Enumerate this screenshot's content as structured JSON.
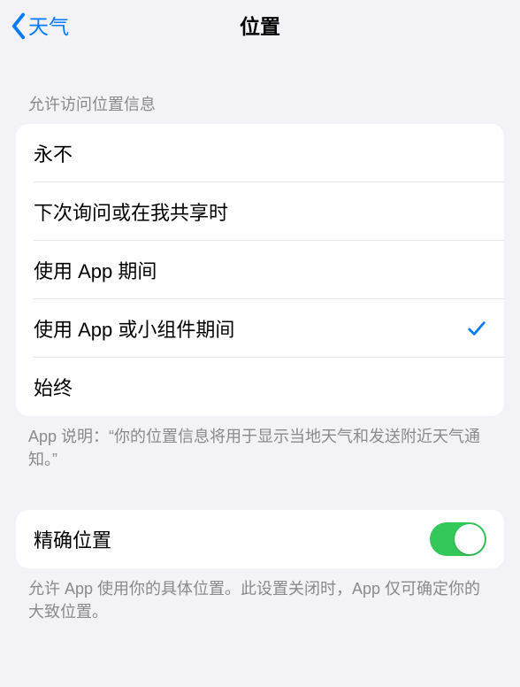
{
  "nav": {
    "back_label": "天气",
    "title": "位置"
  },
  "section1": {
    "header": "允许访问位置信息",
    "options": [
      "永不",
      "下次询问或在我共享时",
      "使用 App 期间",
      "使用 App 或小组件期间",
      "始终"
    ],
    "selected_index": 3,
    "footer": "App 说明：“你的位置信息将用于显示当地天气和发送附近天气通知。”"
  },
  "section2": {
    "row_label": "精确位置",
    "switch_on": true,
    "footer": "允许 App 使用你的具体位置。此设置关闭时，App 仅可确定你的大致位置。"
  }
}
